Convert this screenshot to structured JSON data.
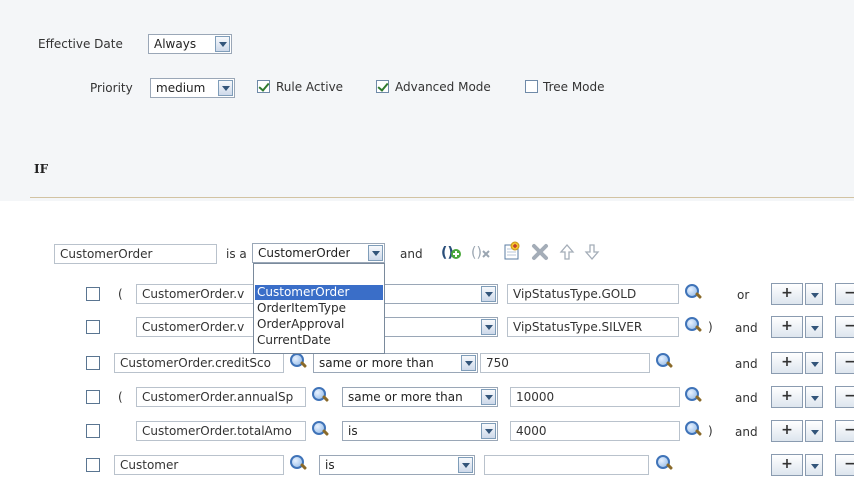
{
  "settings": {
    "effective_date_label": "Effective Date",
    "effective_date_value": "Always",
    "priority_label": "Priority",
    "priority_value": "medium",
    "rule_active_label": "Rule Active",
    "rule_active_checked": true,
    "advanced_mode_label": "Advanced Mode",
    "advanced_mode_checked": true,
    "tree_mode_label": "Tree Mode",
    "tree_mode_checked": false
  },
  "if_heading": "IF",
  "pattern": {
    "variable": "CustomerOrder",
    "is_a_label": "is a",
    "type_value": "CustomerOrder",
    "and_label": "and"
  },
  "type_dropdown": {
    "options": [
      "CustomerOrder",
      "OrderItemType",
      "OrderApproval",
      "CurrentDate"
    ],
    "selected": "CustomerOrder"
  },
  "toolbar_icons": [
    "add-group-icon",
    "remove-group-icon",
    "new-test-icon",
    "delete-icon",
    "move-up-icon",
    "move-down-icon"
  ],
  "conditions": [
    {
      "open_paren": "(",
      "left": "CustomerOrder.v",
      "operator": "",
      "right": "VipStatusType.GOLD",
      "close_paren": "",
      "conj": "or"
    },
    {
      "open_paren": "",
      "left": "CustomerOrder.v",
      "operator": "",
      "right": "VipStatusType.SILVER",
      "close_paren": ")",
      "conj": "and"
    },
    {
      "open_paren": "",
      "left": "CustomerOrder.creditSco",
      "operator": "same or more than",
      "right": "750",
      "close_paren": "",
      "conj": "and"
    },
    {
      "open_paren": "(",
      "left": "CustomerOrder.annualSp",
      "operator": "same or more than",
      "right": "10000",
      "close_paren": "",
      "conj": "and"
    },
    {
      "open_paren": "",
      "left": "CustomerOrder.totalAmo",
      "operator": "is",
      "right": "4000",
      "close_paren": ")",
      "conj": "and"
    },
    {
      "open_paren": "",
      "left": "Customer",
      "operator": "is",
      "right": "",
      "close_paren": "",
      "conj": ""
    }
  ],
  "row_buttons": {
    "add": "+",
    "remove": "−"
  }
}
